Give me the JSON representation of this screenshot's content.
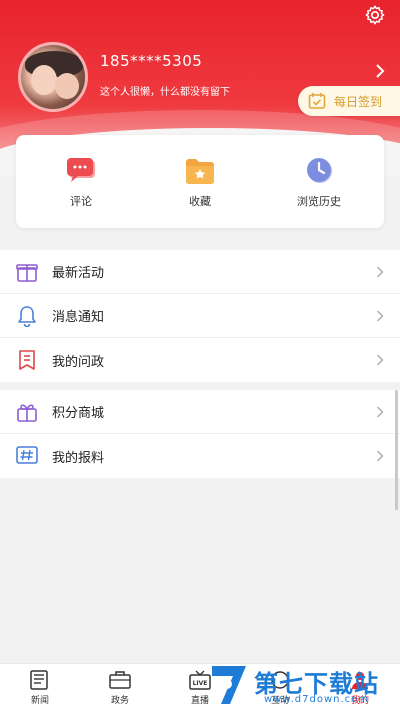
{
  "profile": {
    "phone": "185****5305",
    "signature": "这个人很懒，什么都没有留下"
  },
  "checkin": {
    "label": "每日签到"
  },
  "quick": [
    {
      "label": "评论",
      "icon": "comment-icon"
    },
    {
      "label": "收藏",
      "icon": "folder-star-icon"
    },
    {
      "label": "浏览历史",
      "icon": "clock-icon"
    }
  ],
  "menu1": [
    {
      "label": "最新活动",
      "icon": "gift-icon"
    },
    {
      "label": "消息通知",
      "icon": "bell-icon"
    },
    {
      "label": "我的问政",
      "icon": "bookmark-icon"
    }
  ],
  "menu2": [
    {
      "label": "积分商城",
      "icon": "gift-box-icon"
    },
    {
      "label": "我的报料",
      "icon": "hashtag-icon"
    }
  ],
  "tabs": [
    {
      "label": "新闻",
      "icon": "news-icon"
    },
    {
      "label": "政务",
      "icon": "briefcase-icon"
    },
    {
      "label": "直播",
      "icon": "live-tv-icon"
    },
    {
      "label": "互动",
      "icon": "interact-icon"
    },
    {
      "label": "我的",
      "icon": "user-icon"
    }
  ],
  "watermark": {
    "name": "第七下载站",
    "url": "www.d7down.com"
  },
  "colors": {
    "brand_red": "#e8232d",
    "checkin_gold": "#d79a2e",
    "watermark_blue": "#1e7bd6"
  }
}
